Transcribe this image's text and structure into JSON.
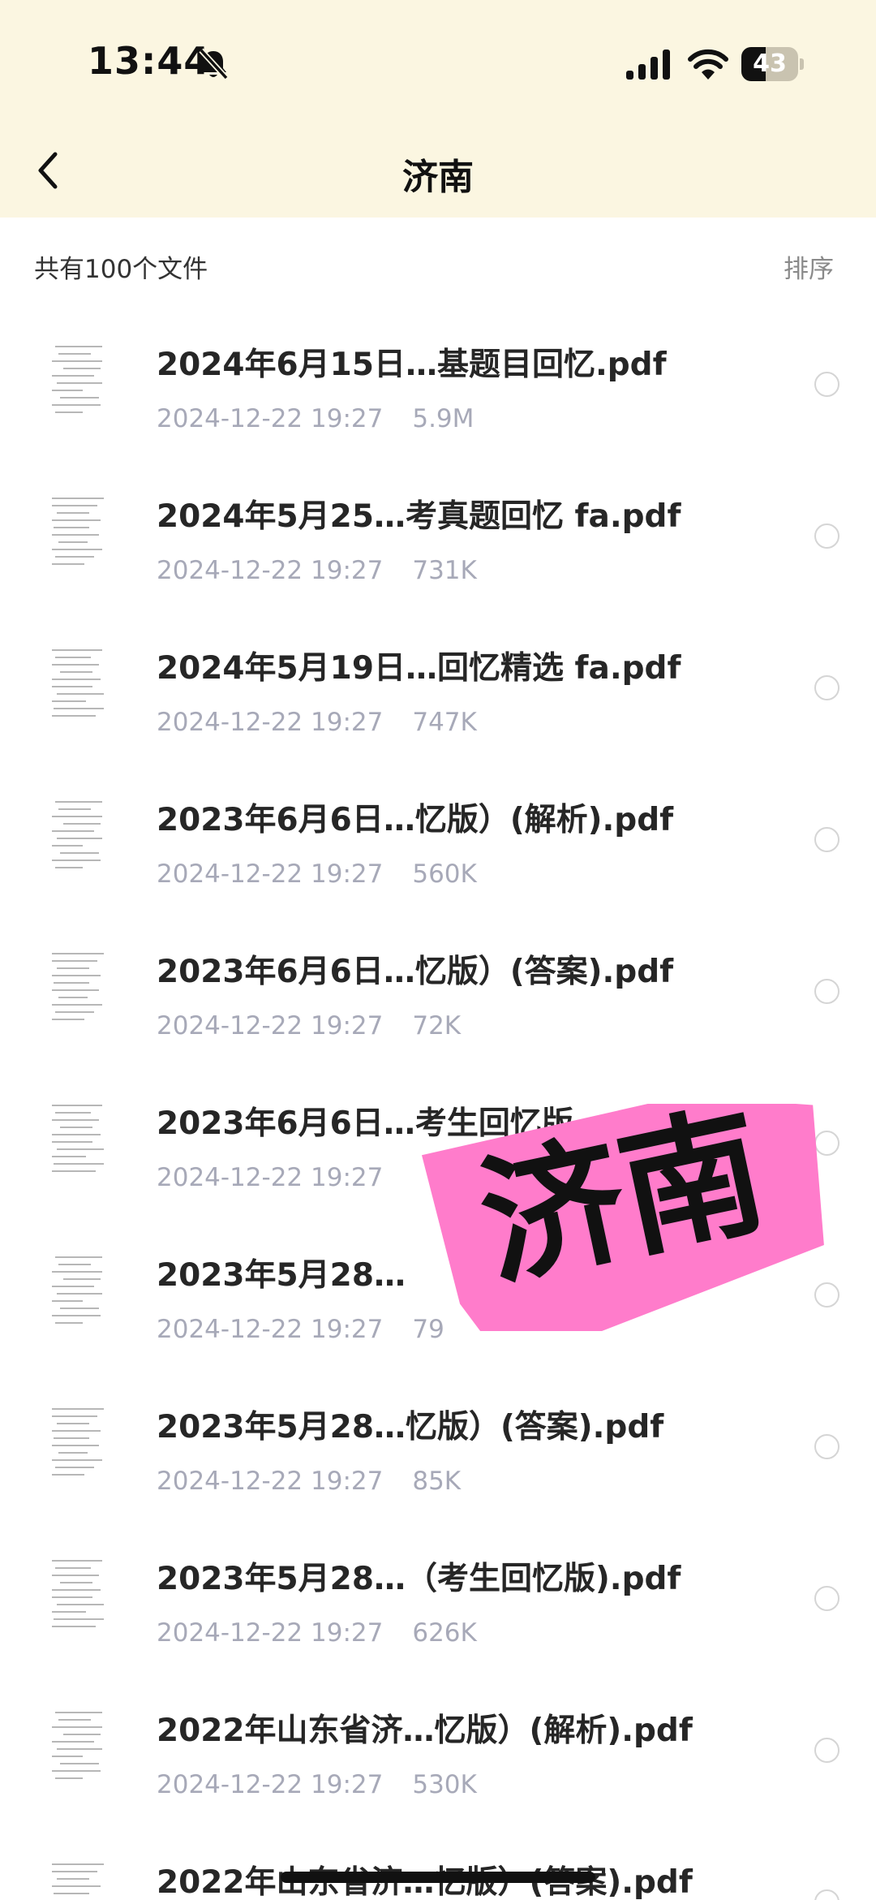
{
  "status_bar": {
    "time": "13:44",
    "battery": "43",
    "battery_level": 0.43,
    "icons": [
      "bell-slash-icon",
      "cellular-signal-icon",
      "wifi-icon",
      "battery-icon"
    ]
  },
  "nav": {
    "title": "济南",
    "back_icon": "chevron-left-icon"
  },
  "summary": {
    "count_text": "共有100个文件",
    "sort_label": "排序"
  },
  "files": [
    {
      "name": "2024年6月15日…基题目回忆.pdf",
      "date": "2024-12-22 19:27",
      "size": "5.9M"
    },
    {
      "name": "2024年5月25…考真题回忆 fa.pdf",
      "date": "2024-12-22 19:27",
      "size": "731K"
    },
    {
      "name": "2024年5月19日…回忆精选 fa.pdf",
      "date": "2024-12-22 19:27",
      "size": "747K"
    },
    {
      "name": "2023年6月6日…忆版）(解析).pdf",
      "date": "2024-12-22 19:27",
      "size": "560K"
    },
    {
      "name": "2023年6月6日…忆版）(答案).pdf",
      "date": "2024-12-22 19:27",
      "size": "72K"
    },
    {
      "name": "2023年6月6日…考生回忆版",
      "date": "2024-12-22 19:27",
      "size": ""
    },
    {
      "name": "2023年5月28…",
      "date": "2024-12-22 19:27",
      "size": "79"
    },
    {
      "name": "2023年5月28…忆版）(答案).pdf",
      "date": "2024-12-22 19:27",
      "size": "85K"
    },
    {
      "name": "2023年5月28…（考生回忆版).pdf",
      "date": "2024-12-22 19:27",
      "size": "626K"
    },
    {
      "name": "2022年山东省济…忆版）(解析).pdf",
      "date": "2024-12-22 19:27",
      "size": "530K"
    },
    {
      "name": "2022年山东省济…忆版）(答案).pdf",
      "date": "",
      "size": ""
    }
  ],
  "overlay_sticker": {
    "text": "济南",
    "color": "#ff7ccb"
  },
  "colors": {
    "header_bg": "#fbf6e1",
    "meta_text": "#a7a9b8"
  }
}
